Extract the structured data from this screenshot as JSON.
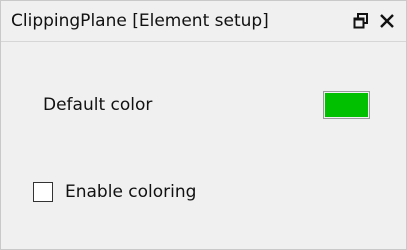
{
  "window": {
    "title": "ClippingPlane [Element setup]",
    "float_icon": "restore-window-icon",
    "close_icon": "close-icon"
  },
  "settings": {
    "default_color_label": "Default color",
    "default_color_value": "#00c000",
    "enable_coloring_label": "Enable coloring",
    "enable_coloring_checked": false
  }
}
